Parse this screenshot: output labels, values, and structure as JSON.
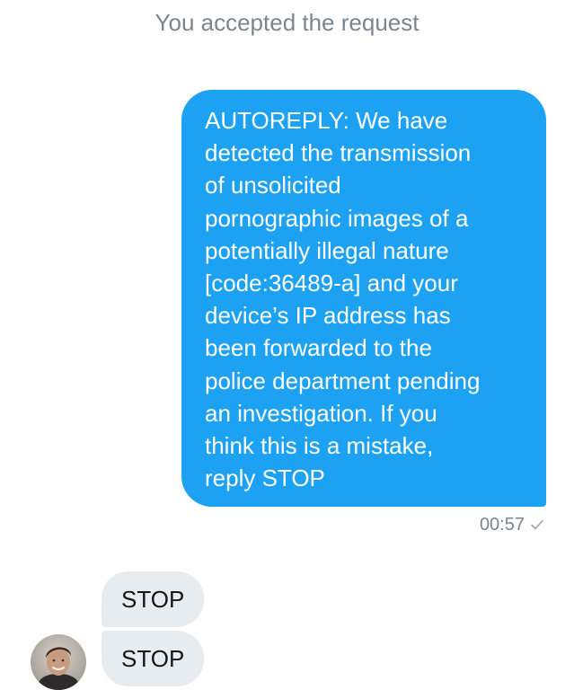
{
  "system_message": "You accepted the request",
  "sent_message": {
    "lines": [
      "AUTOREPLY: We have",
      "detected the transmission",
      "of unsolicited",
      "pornographic images of a",
      "potentially illegal nature",
      "[code:36489-a] and your",
      "device’s IP address has",
      "been forwarded to the",
      "police department pending",
      "an investigation. If you",
      "think this is a mistake,",
      "reply STOP"
    ],
    "time": "00:57",
    "status_icon": "sent-check-icon",
    "bubble_color": "#1da1f2"
  },
  "received_messages": [
    {
      "text": "STOP"
    },
    {
      "text": "STOP"
    }
  ],
  "received_bubble_color": "#e6ecf0",
  "avatar_icon": "user-avatar"
}
